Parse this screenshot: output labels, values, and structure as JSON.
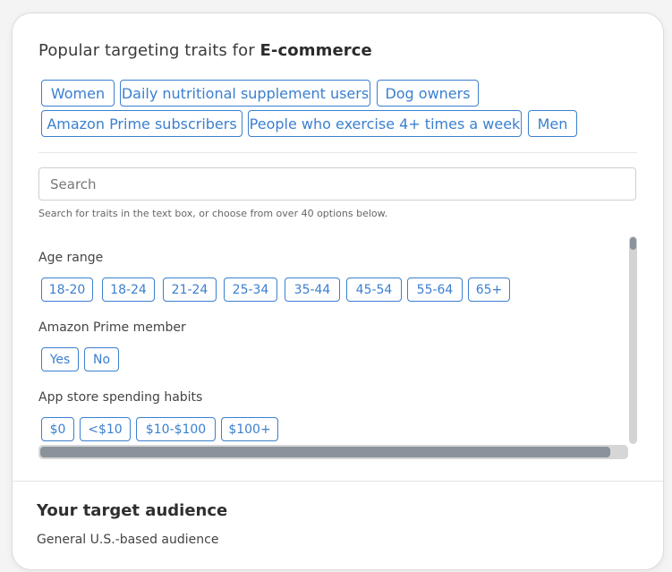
{
  "header": {
    "title_prefix": "Popular targeting traits for",
    "title_category": "E-commerce"
  },
  "popular_traits": [
    "Women",
    "Daily nutritional supplement users",
    "Dog owners",
    "Amazon Prime subscribers",
    "People who exercise 4+ times a week",
    "Men"
  ],
  "search": {
    "placeholder": "Search",
    "value": "",
    "hint": "Search for traits in the text box, or choose from over 40 options below."
  },
  "categories": [
    {
      "label": "Age range",
      "options": [
        "18-20",
        "18-24",
        "21-24",
        "25-34",
        "35-44",
        "45-54",
        "55-64",
        "65+"
      ]
    },
    {
      "label": "Amazon Prime member",
      "options": [
        "Yes",
        "No"
      ]
    },
    {
      "label": "App store spending habits",
      "options": [
        "$0",
        "<$10",
        "$10-$100",
        "$100+"
      ]
    }
  ],
  "scroll": {
    "vertical_position": 0.0,
    "horizontal_position": 0.0
  },
  "audience": {
    "title": "Your target audience",
    "value": "General U.S.-based audience"
  },
  "colors": {
    "accent": "#3b7fcf",
    "text": "#3a3a3a",
    "scroll_thumb": "#8a939c"
  }
}
